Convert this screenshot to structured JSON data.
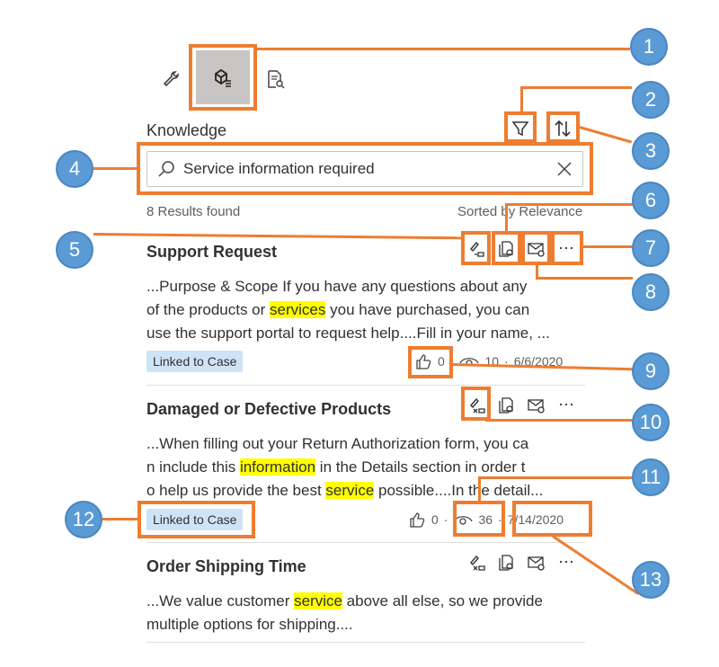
{
  "toolbar": {
    "wrench_icon": "wrench-icon",
    "knowledge_icon": "knowledge-search-icon",
    "doc_search_icon": "document-search-icon"
  },
  "header": {
    "title": "Knowledge",
    "filter_icon": "filter-icon",
    "sort_icon": "sort-icon"
  },
  "search": {
    "value": "Service information required",
    "clear_icon": "close-icon"
  },
  "results": {
    "count_text": "8 Results found",
    "sort_text": "Sorted by Relevance"
  },
  "articles": [
    {
      "title": "Support Request",
      "lines": [
        [
          "...Purpose & Scope If you have any questions about any",
          "",
          ""
        ],
        [
          "of the products or ",
          "services",
          " you have purchased, you can"
        ],
        [
          "use the support portal to request help....Fill in your name, ...",
          "",
          ""
        ]
      ],
      "badge": "Linked to Case",
      "likes": "0",
      "views": "10",
      "date": "6/6/2020"
    },
    {
      "title": "Damaged or Defective Products",
      "lines": [
        [
          "...When filling out your Return Authorization form, you ca",
          "",
          ""
        ],
        [
          "n include this ",
          "information",
          " in the Details section in order t"
        ],
        [
          "o help us provide the best ",
          "service",
          " possible....In the detail..."
        ]
      ],
      "badge": "Linked to Case",
      "likes": "0",
      "views": "36",
      "date": "7/14/2020"
    },
    {
      "title": "Order Shipping Time",
      "lines": [
        [
          "...We value customer ",
          "service",
          " above all else, so we provide"
        ],
        [
          "multiple options for shipping....",
          "",
          ""
        ]
      ]
    }
  ],
  "callouts": [
    "1",
    "2",
    "3",
    "4",
    "5",
    "6",
    "7",
    "8",
    "9",
    "10",
    "11",
    "12",
    "13"
  ],
  "colors": {
    "accent": "#ed7d31",
    "callout": "#5b9bd5",
    "highlight": "#ffff00",
    "badge": "#cfe3f7"
  }
}
